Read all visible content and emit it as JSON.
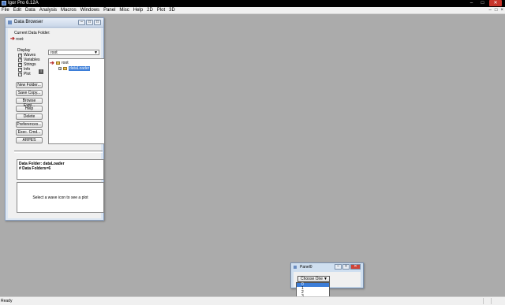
{
  "app": {
    "title": "Igor Pro 6.12A"
  },
  "window_controls": [
    "–",
    "□",
    "✕"
  ],
  "menu": [
    "File",
    "Edit",
    "Data",
    "Analysis",
    "Macros",
    "Windows",
    "Panel",
    "Misc",
    "Help",
    "2D",
    "Plot",
    "3D"
  ],
  "mdi_controls": [
    "–",
    "□",
    "×"
  ],
  "data_browser": {
    "title": "Data Browser",
    "title_controls": [
      "–",
      "□",
      "□"
    ],
    "current_folder_label": "Current Data Folder:",
    "current_folder_value": "root:",
    "display_label": "Display",
    "display_items": [
      "Waves",
      "Variables",
      "Strings",
      "Info",
      "Plot"
    ],
    "info_button": "i",
    "folder_dropdown": "root",
    "buttons": [
      "New Folder...",
      "Save Copy...",
      "Browse Expt...",
      "Help",
      "Delete",
      "Preferences...",
      "Exec. Cmd...",
      "ARPES"
    ],
    "tree": {
      "root": "root",
      "child": "dataLoader",
      "expander": "+"
    },
    "info_lines": [
      "Data Folder: dataLoader",
      "# Data Folders=6"
    ],
    "plot_message": "Select a wave icon to see a plot"
  },
  "panel": {
    "title": "Panel0",
    "controls": [
      "–",
      "□",
      "✕"
    ],
    "popup_label": "Choose One",
    "options": [
      "0",
      "1",
      "2",
      "3"
    ],
    "highlighted_index": 0
  },
  "status": {
    "text": "Ready"
  },
  "icons": [
    "red-arrow-icon",
    "folder-icon",
    "dropdown-arrow-icon",
    "info-icon"
  ],
  "colors": {
    "selection": "#3b7dd8",
    "arrow": "#b22020",
    "workspace": "#ababab"
  }
}
